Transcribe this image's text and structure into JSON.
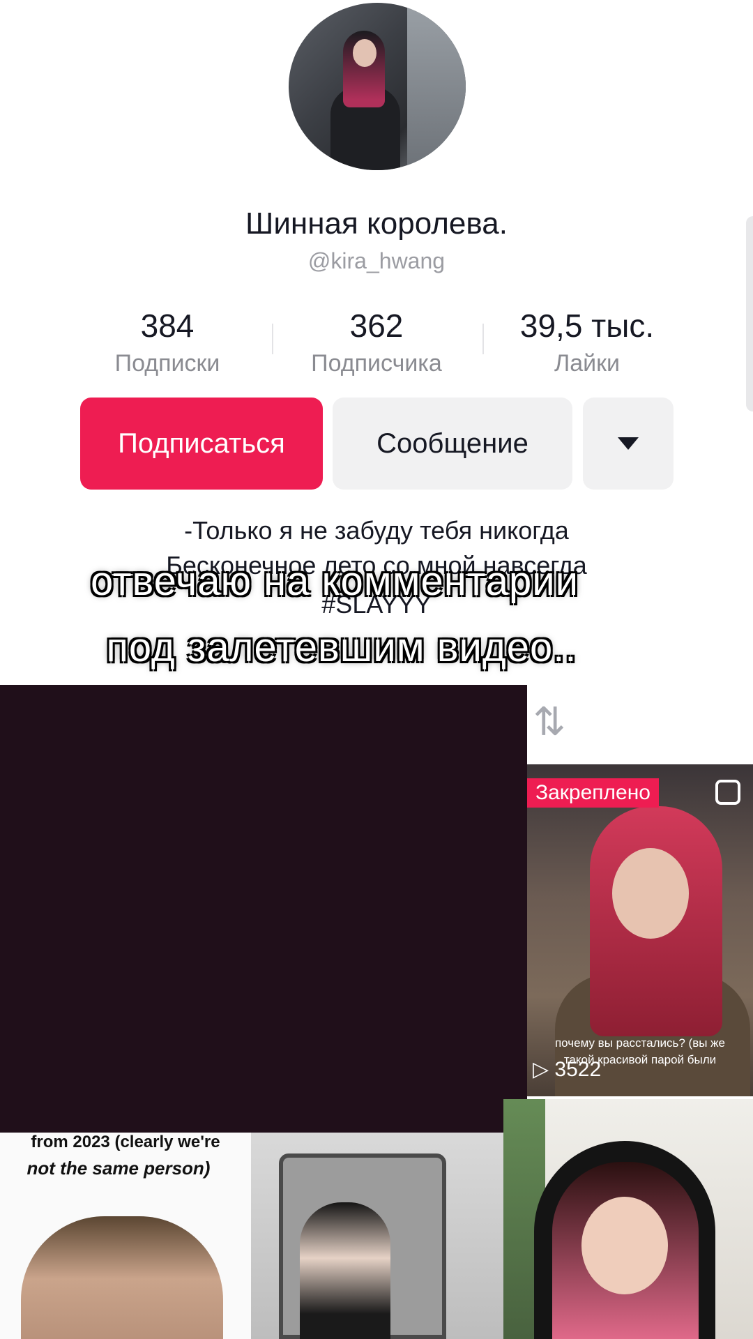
{
  "profile": {
    "display_name": "Шинная королева.",
    "username": "@kira_hwang"
  },
  "stats": [
    {
      "value": "384",
      "label": "Подписки"
    },
    {
      "value": "362",
      "label": "Подписчика"
    },
    {
      "value": "39,5 тыс.",
      "label": "Лайки"
    }
  ],
  "actions": {
    "follow_label": "Подписаться",
    "message_label": "Сообщение",
    "more_icon": "triangle-down-icon"
  },
  "bio": {
    "line1": "-Только я не забуду тебя никогда",
    "line2": "Бесконечное лето со мной навсегда",
    "line3": "#SLAYYY"
  },
  "overlay_caption": {
    "line1": "отвечаю на комментарии",
    "line2": "под залетевшим видео.."
  },
  "videos": {
    "pinned_label": "Закреплено",
    "pinned_text1": "почему вы расстались? (вы же",
    "pinned_text2": "такой красивой парой были",
    "pinned_views": "3522",
    "tile_a_text1": "from 2023 (clearly we're",
    "tile_a_text2": "not the same person)"
  },
  "colors": {
    "accent": "#ee1d52",
    "text": "#161823",
    "secondary_text": "#8a8b91",
    "button_gray": "#f1f1f2",
    "dark_panel": "#200f1a"
  }
}
